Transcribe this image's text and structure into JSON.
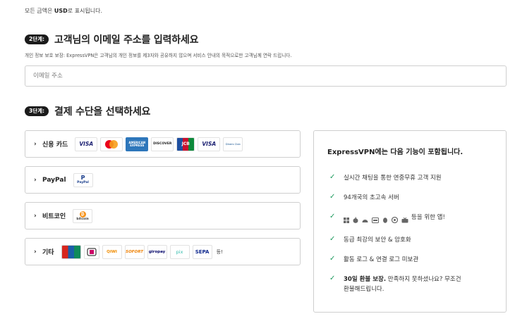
{
  "header": {
    "currency_prefix": "모든 금액은 ",
    "currency_code": "USD",
    "currency_suffix": "로 표시됩니다."
  },
  "step2": {
    "badge": "2단계:",
    "title": "고객님의 이메일 주소를 입력하세요",
    "privacy_note": "개인 정보 보호 보장: ExpressVPN은 고객님의 개인 정보를 제3자와 공유하지 않으며 서비스 안내의 목적으로만 고객님께 연락 드립니다.",
    "email_placeholder": "이메일 주소",
    "email_value": ""
  },
  "step3": {
    "badge": "3단계:",
    "title": "결제 수단을 선택하세요"
  },
  "payment_options": [
    {
      "label": "신용 카드"
    },
    {
      "label": "PayPal"
    },
    {
      "label": "비트코인"
    },
    {
      "label": "기타"
    }
  ],
  "payment_logos": {
    "visa": "VISA",
    "amex": "AMERICAN EXPRESS",
    "discover": "DISCOVER",
    "jcb": "JCB",
    "diners": "Diners Club",
    "paypal": "PayPal",
    "bitcoin": "bitcoin",
    "qiwi": "QIWI",
    "sofort": "SOFORT",
    "giropay": "giropay",
    "pix": "pix",
    "sepa": "SEPA",
    "more": "등!"
  },
  "features": {
    "title": "ExpressVPN에는 다음 기능이 포함됩니다.",
    "items": [
      {
        "text": "실시간 채팅을 통한 연중무휴 고객 지원"
      },
      {
        "text": "94개국의 초고속 서버"
      },
      {
        "text": "등을 위한 앱!"
      },
      {
        "text": "동급 최강의 보안 & 암호화"
      },
      {
        "text": "활동 로그 & 연결 로그 미보관"
      },
      {
        "bold": "30일 환불 보장.",
        "text": " 만족하지 못하셨나요? 무조건",
        "line2": "환불해드립니다."
      }
    ]
  },
  "colors": {
    "accent_check": "#1d9a5e",
    "badge_bg": "#1b1b1b",
    "visa_blue": "#1a1f71"
  }
}
